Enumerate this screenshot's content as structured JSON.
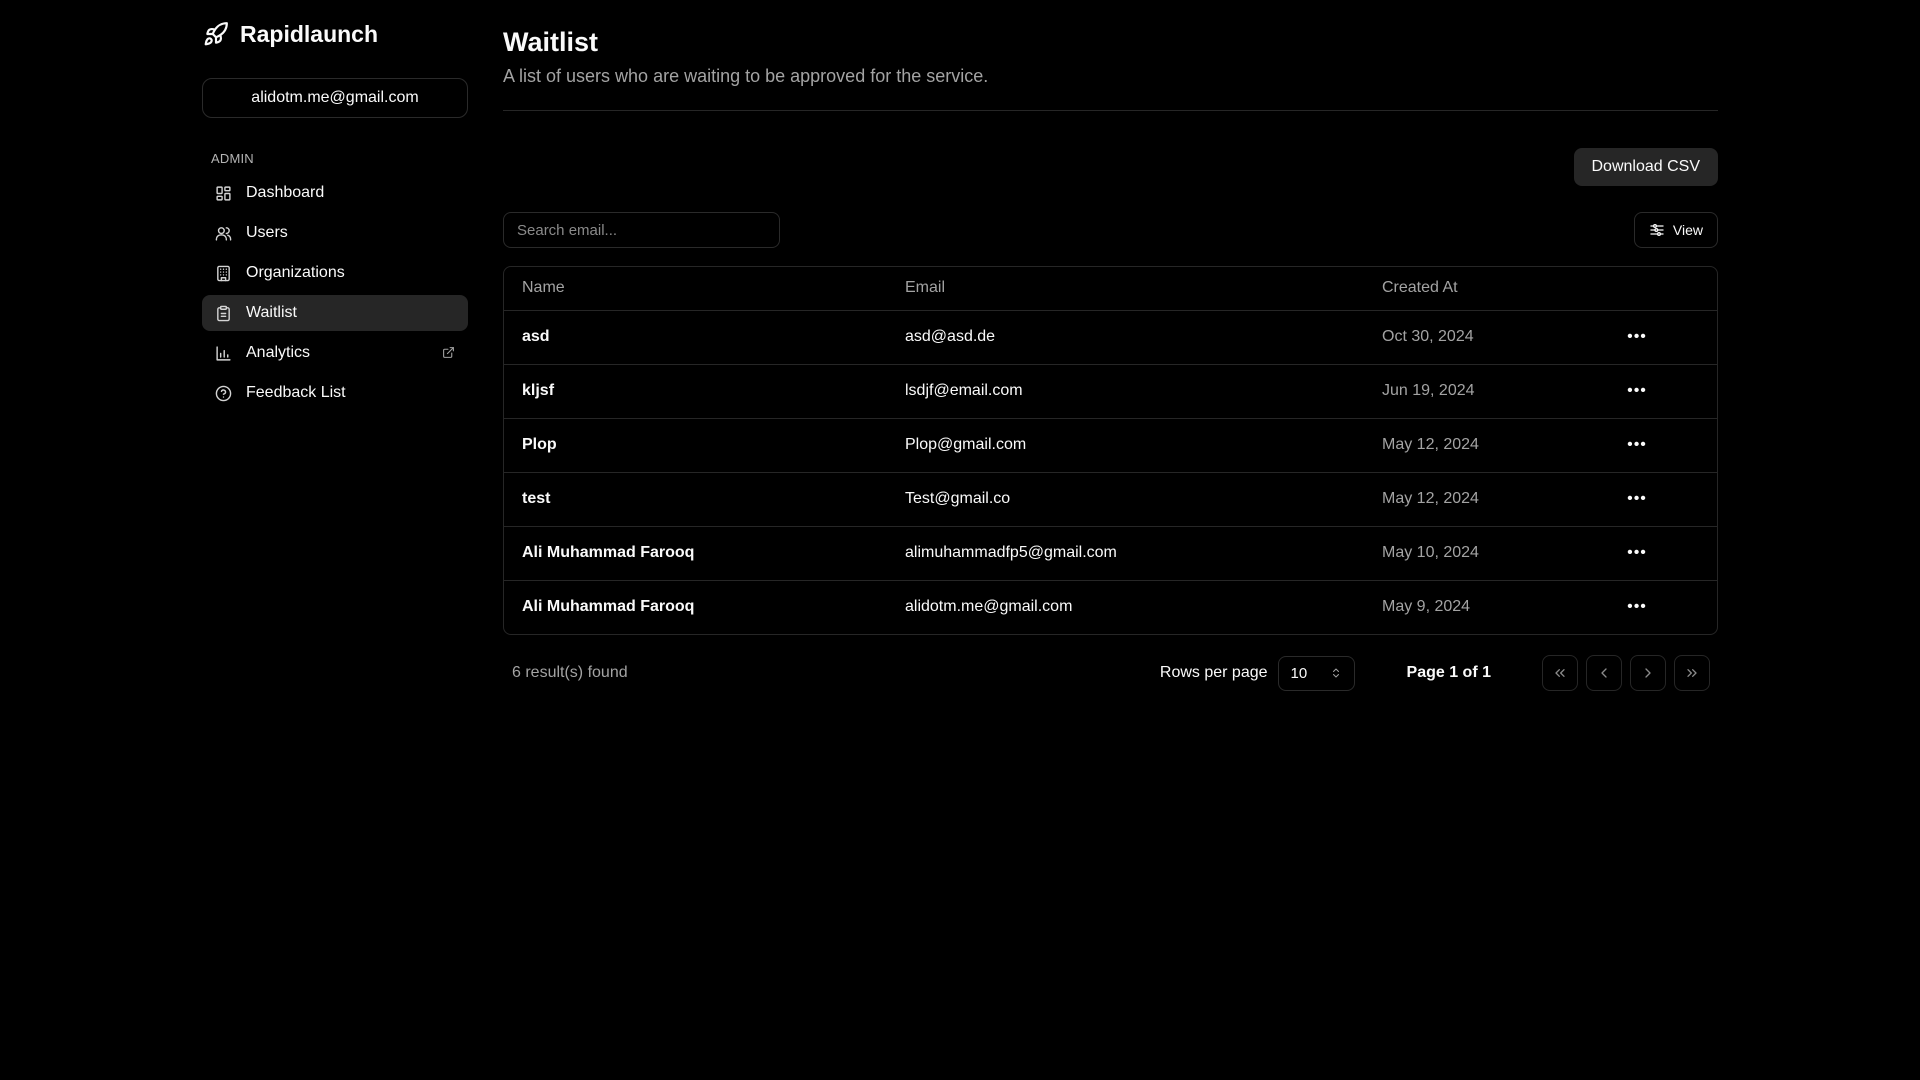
{
  "brand": {
    "name": "Rapidlaunch",
    "icon": "rocket-icon"
  },
  "account": {
    "email": "alidotm.me@gmail.com"
  },
  "sidebar": {
    "section_label": "ADMIN",
    "items": [
      {
        "label": "Dashboard",
        "icon": "dashboard-icon",
        "active": false
      },
      {
        "label": "Users",
        "icon": "users-icon",
        "active": false
      },
      {
        "label": "Organizations",
        "icon": "building-icon",
        "active": false
      },
      {
        "label": "Waitlist",
        "icon": "clipboard-icon",
        "active": true
      },
      {
        "label": "Analytics",
        "icon": "bar-chart-icon",
        "active": false,
        "external": true
      },
      {
        "label": "Feedback List",
        "icon": "help-circle-icon",
        "active": false
      }
    ]
  },
  "page": {
    "title": "Waitlist",
    "subtitle": "A list of users who are waiting to be approved for the service."
  },
  "toolbar": {
    "download_label": "Download CSV",
    "search_placeholder": "Search email...",
    "view_label": "View"
  },
  "table": {
    "columns": [
      "Name",
      "Email",
      "Created At"
    ],
    "rows": [
      {
        "name": "asd",
        "email": "asd@asd.de",
        "created_at": "Oct 30, 2024"
      },
      {
        "name": "kljsf",
        "email": "lsdjf@email.com",
        "created_at": "Jun 19, 2024"
      },
      {
        "name": "Plop",
        "email": "Plop@gmail.com",
        "created_at": "May 12, 2024"
      },
      {
        "name": "test",
        "email": "Test@gmail.co",
        "created_at": "May 12, 2024"
      },
      {
        "name": "Ali Muhammad Farooq",
        "email": "alimuhammadfp5@gmail.com",
        "created_at": "May 10, 2024"
      },
      {
        "name": "Ali Muhammad Farooq",
        "email": "alidotm.me@gmail.com",
        "created_at": "May 9, 2024"
      }
    ]
  },
  "pagination": {
    "results_text": "6 result(s) found",
    "rows_per_page_label": "Rows per page",
    "rows_per_page_value": "10",
    "page_info": "Page 1 of 1"
  },
  "colors": {
    "background": "#000000",
    "active_item": "#262626",
    "border": "#262626",
    "muted_text": "#a3a3a3"
  }
}
